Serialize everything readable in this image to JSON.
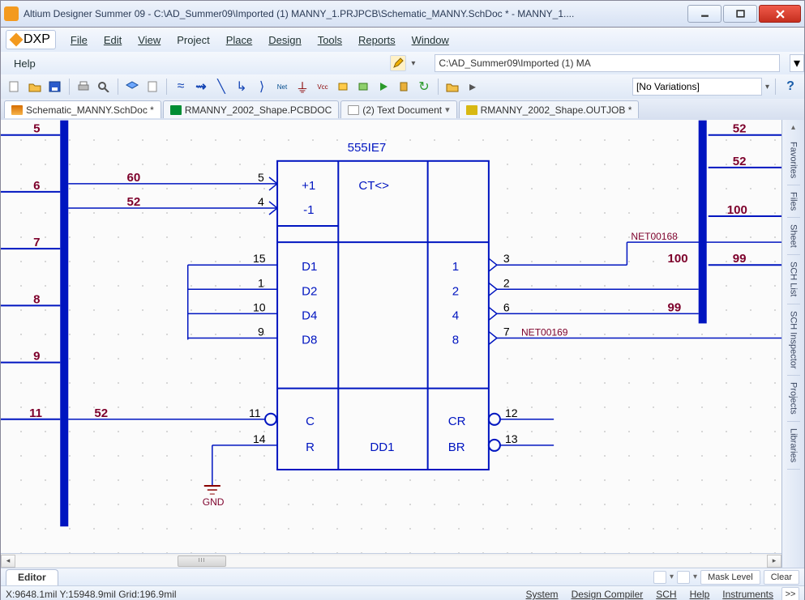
{
  "window": {
    "title": "Altium Designer Summer 09 - C:\\AD_Summer09\\Imported (1) MANNY_1.PRJPCB\\Schematic_MANNY.SchDoc * - MANNY_1....",
    "min_tooltip": "Minimize",
    "max_tooltip": "Maximize",
    "close_tooltip": "Close"
  },
  "menu": {
    "dxp": "DXP",
    "file": "File",
    "edit": "Edit",
    "view": "View",
    "project": "Project",
    "place": "Place",
    "design": "Design",
    "tools": "Tools",
    "reports": "Reports",
    "window": "Window",
    "help": "Help"
  },
  "path_field": "C:\\AD_Summer09\\Imported (1) MA",
  "variations": {
    "label": "[No Variations]"
  },
  "tabs": [
    {
      "label": "Schematic_MANNY.SchDoc *",
      "suffix": "*"
    },
    {
      "label": "RMANNY_2002_Shape.PCBDOC",
      "suffix": ""
    },
    {
      "label": "(2) Text Document",
      "suffix": "▾"
    },
    {
      "label": "RMANNY_2002_Shape.OUTJOB *",
      "suffix": "*"
    }
  ],
  "side_tabs": [
    "Favorites",
    "Files",
    "Sheet",
    "SCH List",
    "SCH Inspector",
    "Projects",
    "Libraries"
  ],
  "component": {
    "designator": "555IE7",
    "value": "DD1",
    "pins_left_top": [
      {
        "num": "5",
        "name": "+1"
      },
      {
        "num": "4",
        "name": "-1"
      }
    ],
    "pins_left_mid": [
      {
        "num": "15",
        "name": "D1"
      },
      {
        "num": "1",
        "name": "D2"
      },
      {
        "num": "10",
        "name": "D4"
      },
      {
        "num": "9",
        "name": "D8"
      }
    ],
    "pins_left_bot": [
      {
        "num": "11",
        "name": "C"
      },
      {
        "num": "14",
        "name": "R"
      }
    ],
    "center_top": "CT<>",
    "pins_right_mid": [
      {
        "num": "3",
        "name": "1"
      },
      {
        "num": "2",
        "name": "2"
      },
      {
        "num": "6",
        "name": "4"
      },
      {
        "num": "7",
        "name": "8"
      }
    ],
    "pins_right_bot": [
      {
        "num": "12",
        "name": "CR"
      },
      {
        "num": "13",
        "name": "BR"
      }
    ]
  },
  "nets": {
    "left_bus_labels": [
      "5",
      "6",
      "7",
      "8",
      "9",
      "11"
    ],
    "left_net_upper": [
      "60",
      "52"
    ],
    "left_net_c": "52",
    "gnd": "GND",
    "right_top_labels": [
      "52",
      "52",
      "100"
    ],
    "net168": "NET00168",
    "net168_pair": [
      "100",
      "99"
    ],
    "net_99": "99",
    "net169": "NET00169"
  },
  "editor_tab": "Editor",
  "mask_btn": "Mask Level",
  "clear_btn": "Clear",
  "status": {
    "coords": "X:9648.1mil Y:15948.9mil   Grid:196.9mil"
  },
  "bottom_links": [
    "System",
    "Design Compiler",
    "SCH",
    "Help",
    "Instruments"
  ],
  "more": ">>",
  "scroll_thumb": "III"
}
